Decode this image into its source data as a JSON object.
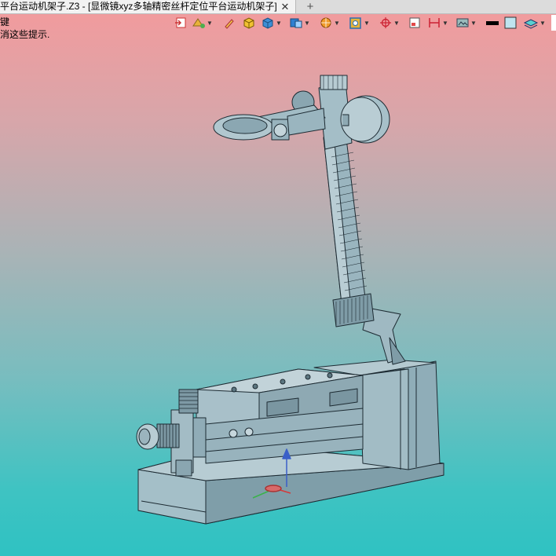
{
  "window": {
    "tab_title": "平台运动机架子.Z3 - [显微镜xyz多轴精密丝杆定位平台运动机架子]",
    "tab_close": "✕",
    "new_tab": "+"
  },
  "status": {
    "line1": "键",
    "line2": "消这些提示."
  },
  "toolbar": {
    "icons": [
      "exit-sketch-icon",
      "color-filter-icon",
      "pencil-eraser-icon",
      "shaded-box-icon",
      "view-cube-icon",
      "display-mode-icon",
      "render-sphere-icon",
      "texture-mapping-icon",
      "snap-target-icon",
      "frame-icon",
      "dimension-icon",
      "screen-capture-icon",
      "line-color-icon",
      "face-color-icon",
      "layer-icon"
    ]
  },
  "colors": {
    "background_top": "#f49a9c",
    "background_bottom": "#2fc2c2",
    "model_fill": "#9ab7c1",
    "model_edge": "#1d2b33"
  }
}
